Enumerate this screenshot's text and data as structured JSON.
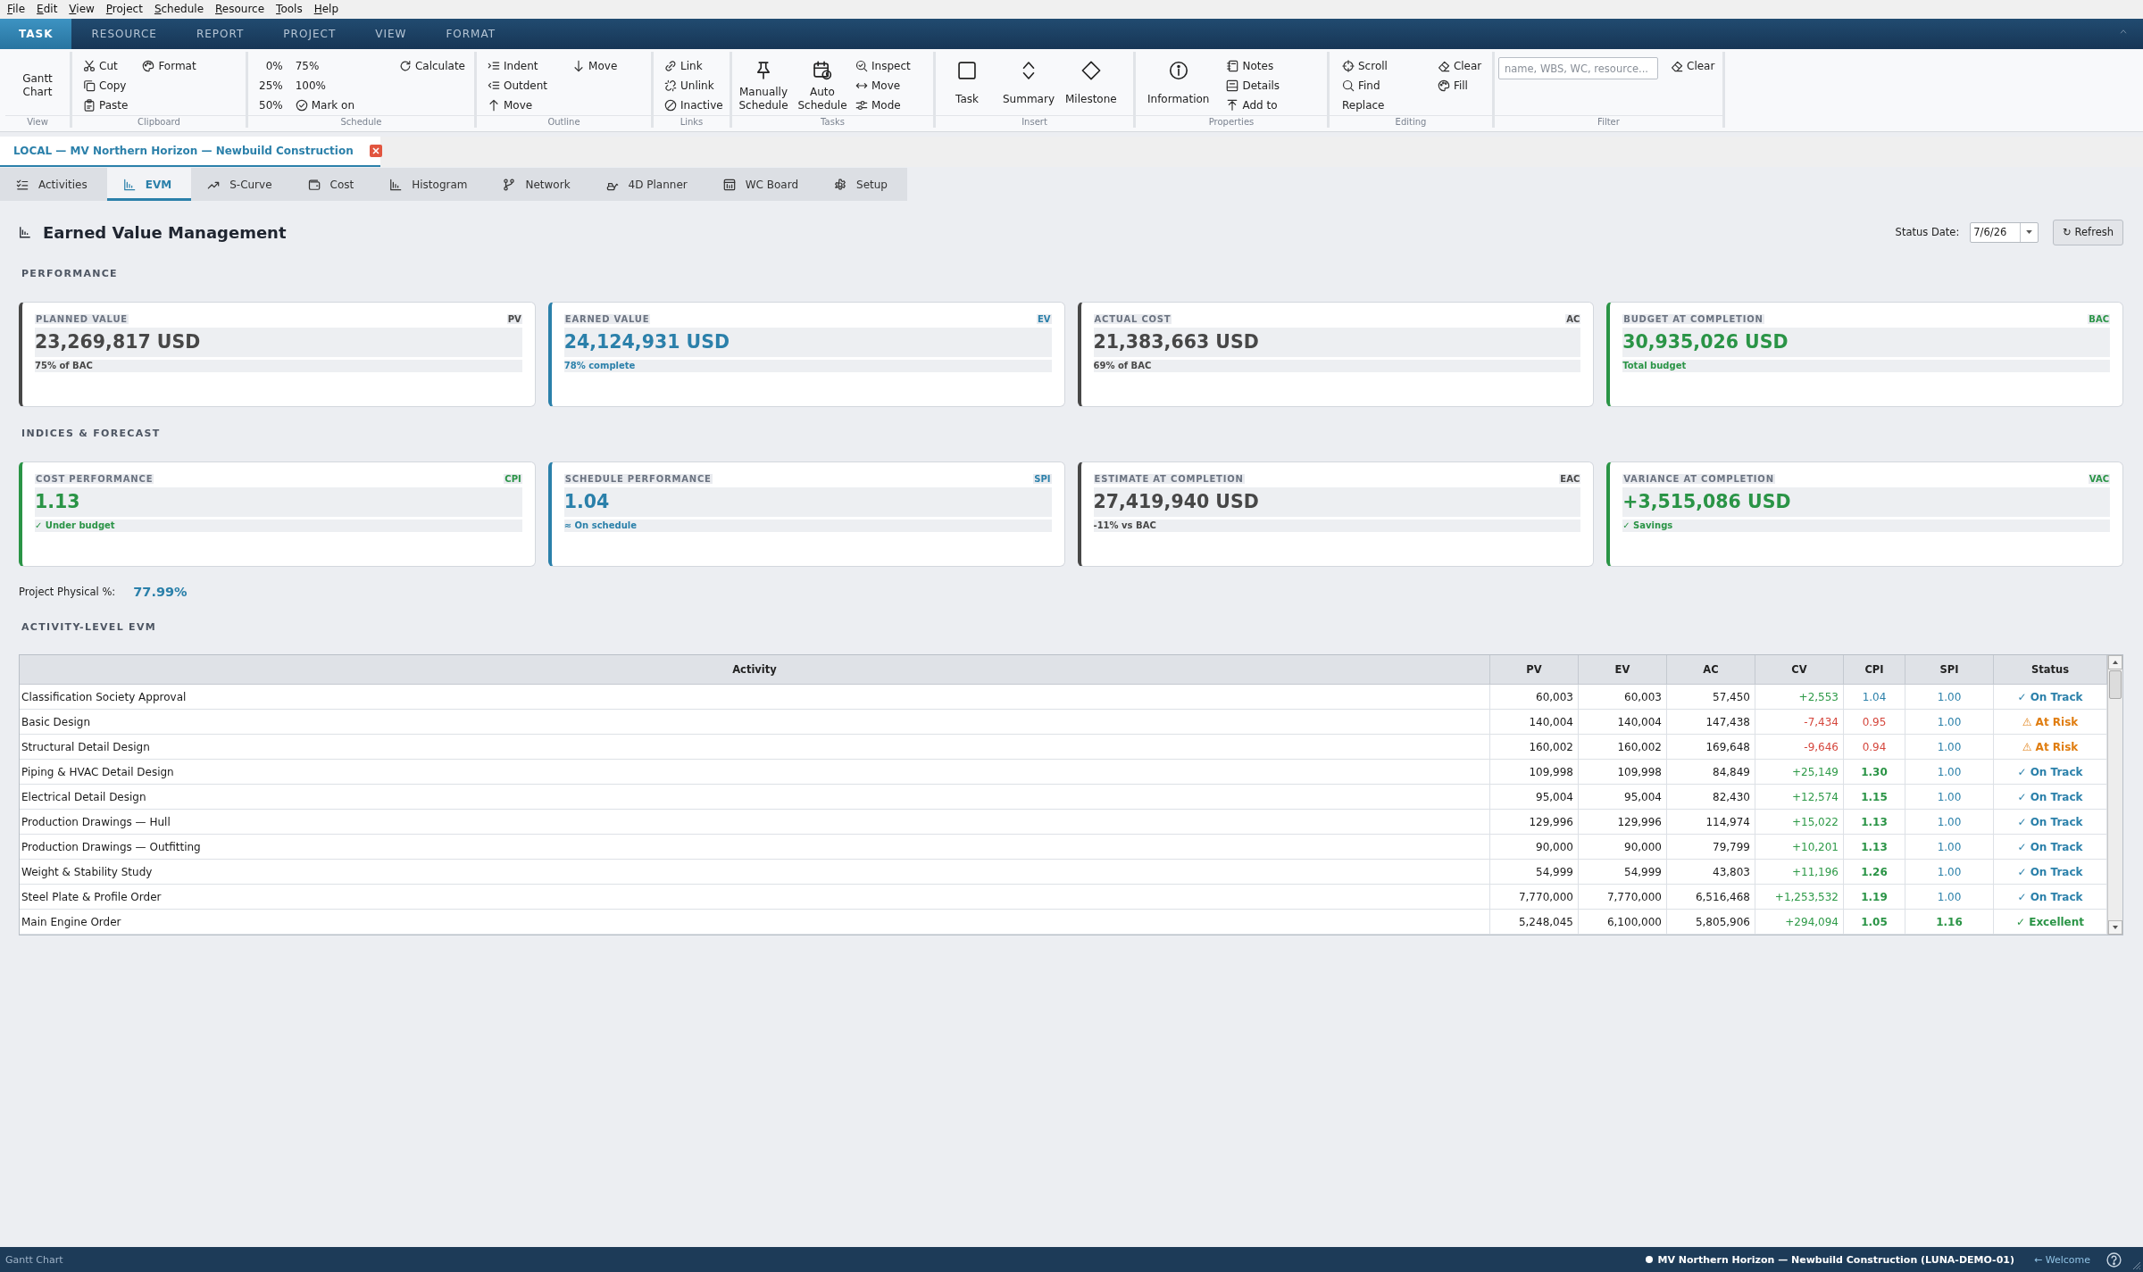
{
  "menu_bar": [
    "File",
    "Edit",
    "View",
    "Project",
    "Schedule",
    "Resource",
    "Tools",
    "Help"
  ],
  "ribbon": {
    "tabs": [
      {
        "label": "TASK",
        "selected": true
      },
      {
        "label": "RESOURCE",
        "selected": false
      },
      {
        "label": "REPORT",
        "selected": false
      },
      {
        "label": "PROJECT",
        "selected": false
      },
      {
        "label": "VIEW",
        "selected": false
      },
      {
        "label": "FORMAT",
        "selected": false
      }
    ],
    "groups": [
      {
        "label": "View",
        "items": [
          {
            "kind": "large",
            "label": "Gantt Chart"
          }
        ]
      },
      {
        "label": "Clipboard",
        "items": [
          {
            "kind": "column",
            "buttons": [
              {
                "label": "Cut"
              },
              {
                "label": "Copy"
              },
              {
                "label": "Paste"
              }
            ]
          },
          {
            "kind": "column",
            "buttons": [
              {
                "label": "Format"
              }
            ]
          }
        ]
      },
      {
        "label": "Schedule",
        "items": [
          {
            "kind": "column",
            "buttons": [
              {
                "label": "0%"
              },
              {
                "label": "25%"
              },
              {
                "label": "50%"
              }
            ]
          },
          {
            "kind": "column",
            "buttons": [
              {
                "label": "75%"
              },
              {
                "label": "100%"
              },
              {
                "label": "Mark on"
              }
            ]
          },
          {
            "kind": "column",
            "buttons": [
              {
                "label": "Calculate"
              }
            ]
          }
        ]
      },
      {
        "label": "Outline",
        "items": [
          {
            "kind": "column",
            "buttons": [
              {
                "label": "Indent"
              },
              {
                "label": "Outdent"
              },
              {
                "label": "Move"
              }
            ]
          },
          {
            "kind": "column",
            "buttons": [
              {
                "label": "Move"
              }
            ]
          }
        ]
      },
      {
        "label": "Links",
        "items": [
          {
            "kind": "column",
            "buttons": [
              {
                "label": "Link"
              },
              {
                "label": "Unlink"
              },
              {
                "label": "Inactive"
              }
            ]
          }
        ]
      },
      {
        "label": "Tasks",
        "items": [
          {
            "kind": "large",
            "label": "Manually Schedule"
          },
          {
            "kind": "large",
            "label": "Auto Schedule"
          },
          {
            "kind": "column",
            "buttons": [
              {
                "label": "Inspect"
              },
              {
                "label": "Move"
              },
              {
                "label": "Mode"
              }
            ]
          }
        ]
      },
      {
        "label": "Insert",
        "items": [
          {
            "kind": "large",
            "label": "Task"
          },
          {
            "kind": "large",
            "label": "Summary"
          },
          {
            "kind": "large",
            "label": "Milestone"
          }
        ]
      },
      {
        "label": "Properties",
        "items": [
          {
            "kind": "large",
            "label": "Information"
          },
          {
            "kind": "column",
            "buttons": [
              {
                "label": "Notes"
              },
              {
                "label": "Details"
              },
              {
                "label": "Add to"
              }
            ]
          }
        ]
      },
      {
        "label": "Editing",
        "items": [
          {
            "kind": "column",
            "buttons": [
              {
                "label": "Scroll"
              },
              {
                "label": "Find"
              },
              {
                "label": "Replace"
              }
            ]
          },
          {
            "kind": "column",
            "buttons": [
              {
                "label": "Clear"
              },
              {
                "label": "Fill"
              }
            ]
          }
        ]
      },
      {
        "label": "Filter",
        "items": [
          {
            "kind": "field",
            "placeholder": "name, WBS, WC, resource..."
          },
          {
            "kind": "column",
            "buttons": [
              {
                "label": "Clear"
              }
            ]
          }
        ]
      }
    ]
  },
  "document_tab": {
    "title": "LOCAL — MV Northern Horizon — Newbuild Construction"
  },
  "view_tabs": [
    {
      "label": "Activities",
      "selected": false
    },
    {
      "label": "EVM",
      "selected": true
    },
    {
      "label": "S-Curve",
      "selected": false
    },
    {
      "label": "Cost",
      "selected": false
    },
    {
      "label": "Histogram",
      "selected": false
    },
    {
      "label": "Network",
      "selected": false
    },
    {
      "label": "4D Planner",
      "selected": false
    },
    {
      "label": "WC Board",
      "selected": false
    },
    {
      "label": "Setup",
      "selected": false
    }
  ],
  "page": {
    "title": "Earned Value Management",
    "status_date": {
      "label": "Status Date:",
      "value": "7/6/26"
    },
    "refresh_button": "↻ Refresh"
  },
  "sections": [
    {
      "heading": "PERFORMANCE",
      "cards": [
        {
          "label": "PLANNED VALUE",
          "abbr": "PV",
          "value": "23,269,817 USD",
          "note": "75% of BAC",
          "color": "#474747"
        },
        {
          "label": "EARNED VALUE",
          "abbr": "EV",
          "value": "24,124,931 USD",
          "note": "78% complete",
          "color": "#2b80aa"
        },
        {
          "label": "ACTUAL COST",
          "abbr": "AC",
          "value": "21,383,663 USD",
          "note": "69% of BAC",
          "color": "#474747"
        },
        {
          "label": "BUDGET AT COMPLETION",
          "abbr": "BAC",
          "value": "30,935,026 USD",
          "note": "Total budget",
          "color": "#2a9446"
        }
      ]
    },
    {
      "heading": "INDICES & FORECAST",
      "cards": [
        {
          "label": "COST PERFORMANCE",
          "abbr": "CPI",
          "value": "1.13",
          "note": "✓ Under budget",
          "color": "#2a9446"
        },
        {
          "label": "SCHEDULE PERFORMANCE",
          "abbr": "SPI",
          "value": "1.04",
          "note": "≈ On schedule",
          "color": "#2b80aa"
        },
        {
          "label": "ESTIMATE AT COMPLETION",
          "abbr": "EAC",
          "value": "27,419,940 USD",
          "note": "-11% vs BAC",
          "color": "#474747"
        },
        {
          "label": "VARIANCE AT COMPLETION",
          "abbr": "VAC",
          "value": "+3,515,086 USD",
          "note": "✓ Savings",
          "color": "#2a9446"
        }
      ]
    }
  ],
  "physical_percent": {
    "label": "Project Physical %:",
    "value": "77.99%"
  },
  "activity_table": {
    "heading": "ACTIVITY-LEVEL EVM",
    "columns": [
      "Activity",
      "PV",
      "EV",
      "AC",
      "CV",
      "CPI",
      "SPI",
      "Status"
    ],
    "rows": [
      {
        "activity": "Classification Society Approval",
        "pv": "60,003",
        "ev": "60,003",
        "ac": "57,450",
        "cv": {
          "text": "+2,553",
          "kind": "gain"
        },
        "cpi": {
          "text": "1.04",
          "kind": "normal"
        },
        "spi": {
          "text": "1.00",
          "kind": "normal"
        },
        "status": {
          "text": "✓ On Track",
          "kind": "on_track"
        }
      },
      {
        "activity": "Basic Design",
        "pv": "140,004",
        "ev": "140,004",
        "ac": "147,438",
        "cv": {
          "text": "-7,434",
          "kind": "loss"
        },
        "cpi": {
          "text": "0.95",
          "kind": "low"
        },
        "spi": {
          "text": "1.00",
          "kind": "normal"
        },
        "status": {
          "text": "⚠ At Risk",
          "kind": "at_risk"
        }
      },
      {
        "activity": "Structural Detail Design",
        "pv": "160,002",
        "ev": "160,002",
        "ac": "169,648",
        "cv": {
          "text": "-9,646",
          "kind": "loss"
        },
        "cpi": {
          "text": "0.94",
          "kind": "low"
        },
        "spi": {
          "text": "1.00",
          "kind": "normal"
        },
        "status": {
          "text": "⚠ At Risk",
          "kind": "at_risk"
        }
      },
      {
        "activity": "Piping & HVAC Detail Design",
        "pv": "109,998",
        "ev": "109,998",
        "ac": "84,849",
        "cv": {
          "text": "+25,149",
          "kind": "gain"
        },
        "cpi": {
          "text": "1.30",
          "kind": "high"
        },
        "spi": {
          "text": "1.00",
          "kind": "normal"
        },
        "status": {
          "text": "✓ On Track",
          "kind": "on_track"
        }
      },
      {
        "activity": "Electrical Detail Design",
        "pv": "95,004",
        "ev": "95,004",
        "ac": "82,430",
        "cv": {
          "text": "+12,574",
          "kind": "gain"
        },
        "cpi": {
          "text": "1.15",
          "kind": "high"
        },
        "spi": {
          "text": "1.00",
          "kind": "normal"
        },
        "status": {
          "text": "✓ On Track",
          "kind": "on_track"
        }
      },
      {
        "activity": "Production Drawings — Hull",
        "pv": "129,996",
        "ev": "129,996",
        "ac": "114,974",
        "cv": {
          "text": "+15,022",
          "kind": "gain"
        },
        "cpi": {
          "text": "1.13",
          "kind": "high"
        },
        "spi": {
          "text": "1.00",
          "kind": "normal"
        },
        "status": {
          "text": "✓ On Track",
          "kind": "on_track"
        }
      },
      {
        "activity": "Production Drawings — Outfitting",
        "pv": "90,000",
        "ev": "90,000",
        "ac": "79,799",
        "cv": {
          "text": "+10,201",
          "kind": "gain"
        },
        "cpi": {
          "text": "1.13",
          "kind": "high"
        },
        "spi": {
          "text": "1.00",
          "kind": "normal"
        },
        "status": {
          "text": "✓ On Track",
          "kind": "on_track"
        }
      },
      {
        "activity": "Weight & Stability Study",
        "pv": "54,999",
        "ev": "54,999",
        "ac": "43,803",
        "cv": {
          "text": "+11,196",
          "kind": "gain"
        },
        "cpi": {
          "text": "1.26",
          "kind": "high"
        },
        "spi": {
          "text": "1.00",
          "kind": "normal"
        },
        "status": {
          "text": "✓ On Track",
          "kind": "on_track"
        }
      },
      {
        "activity": "Steel Plate & Profile Order",
        "pv": "7,770,000",
        "ev": "7,770,000",
        "ac": "6,516,468",
        "cv": {
          "text": "+1,253,532",
          "kind": "gain"
        },
        "cpi": {
          "text": "1.19",
          "kind": "high"
        },
        "spi": {
          "text": "1.00",
          "kind": "normal"
        },
        "status": {
          "text": "✓ On Track",
          "kind": "on_track"
        }
      },
      {
        "activity": "Main Engine Order",
        "pv": "5,248,045",
        "ev": "6,100,000",
        "ac": "5,805,906",
        "cv": {
          "text": "+294,094",
          "kind": "gain"
        },
        "cpi": {
          "text": "1.05",
          "kind": "high"
        },
        "spi": {
          "text": "1.16",
          "kind": "high"
        },
        "status": {
          "text": "✓ Excellent",
          "kind": "excellent"
        }
      }
    ]
  },
  "status_bar": {
    "left": "Gantt Chart",
    "project": "MV Northern Horizon — Newbuild Construction (LUNA-DEMO-01)",
    "link": "← Welcome"
  }
}
